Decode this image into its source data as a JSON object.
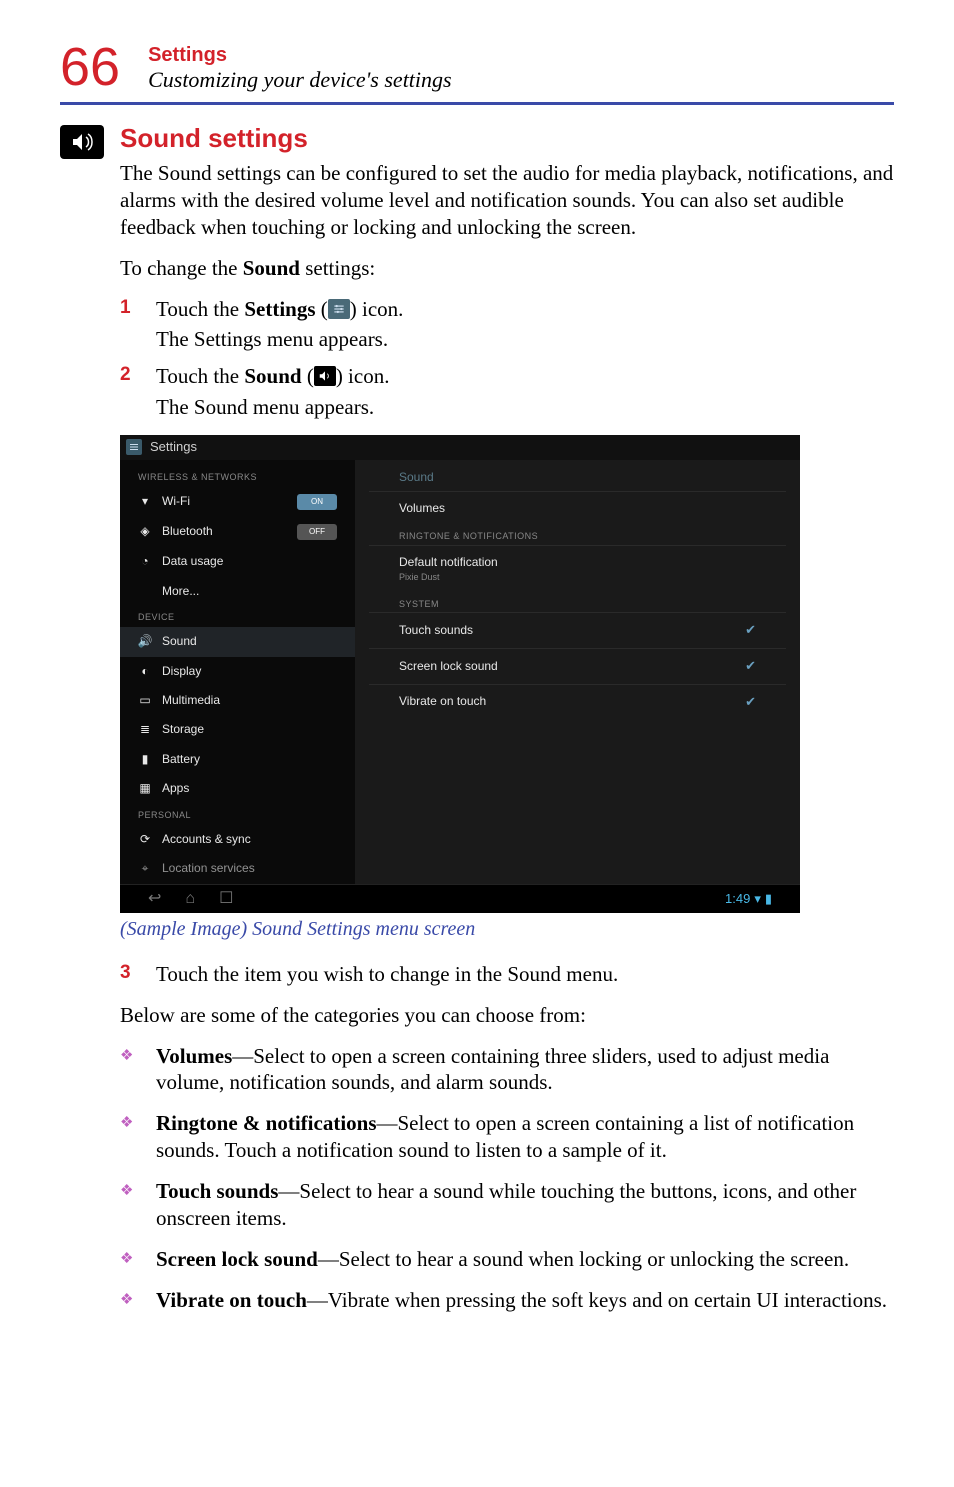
{
  "header": {
    "page_number": "66",
    "title": "Settings",
    "subtitle": "Customizing your device's settings"
  },
  "section": {
    "title": "Sound settings",
    "intro": "The Sound settings can be configured to set the audio for media playback, notifications, and alarms with the desired volume level and notification sounds. You can also set audible feedback when touching or locking and unlocking the screen.",
    "lead": "To change the Sound settings:"
  },
  "steps": {
    "s1_num": "1",
    "s1_a": "Touch the ",
    "s1_b": "Settings",
    "s1_c": " (",
    "s1_d": ") icon.",
    "s1_sub": "The Settings menu appears.",
    "s2_num": "2",
    "s2_a": "Touch the ",
    "s2_b": "Sound",
    "s2_c": " (",
    "s2_d": ") icon.",
    "s2_sub": "The Sound menu appears.",
    "s3_num": "3",
    "s3_text": "Touch the item you wish to change in the Sound menu."
  },
  "screenshot": {
    "title": "Settings",
    "cat_wireless": "WIRELESS & NETWORKS",
    "wifi": "Wi-Fi",
    "wifi_toggle": "ON",
    "bluetooth": "Bluetooth",
    "bt_toggle": "OFF",
    "data": "Data usage",
    "more": "More...",
    "cat_device": "DEVICE",
    "sound": "Sound",
    "display": "Display",
    "multimedia": "Multimedia",
    "storage": "Storage",
    "battery": "Battery",
    "apps": "Apps",
    "cat_personal": "PERSONAL",
    "accounts": "Accounts & sync",
    "location": "Location services",
    "right_hdr": "Sound",
    "volumes": "Volumes",
    "cat_ring": "RINGTONE & NOTIFICATIONS",
    "default_notif": "Default notification",
    "default_notif_sub": "Pixie Dust",
    "cat_system": "SYSTEM",
    "touch_sounds": "Touch sounds",
    "screen_lock": "Screen lock sound",
    "vibrate": "Vibrate on touch",
    "time": "1:49"
  },
  "caption": "(Sample Image) Sound Settings menu screen",
  "below": "Below are some of the categories you can choose from:",
  "bullets": {
    "b1_t": "Volumes",
    "b1_r": "—Select to open a screen containing three sliders, used to adjust media volume, notification sounds, and alarm sounds.",
    "b2_t": "Ringtone & notifications",
    "b2_r": "—Select to open a screen containing a list of notification sounds. Touch a notification sound to listen to a sample of it.",
    "b3_t": "Touch sounds",
    "b3_r": "—Select to hear a sound while touching the buttons, icons, and other onscreen items.",
    "b4_t": "Screen lock sound",
    "b4_r": "—Select to hear a sound when locking or unlocking the screen.",
    "b5_t": "Vibrate on touch",
    "b5_r": "—Vibrate when pressing the soft keys and on certain UI interactions."
  }
}
